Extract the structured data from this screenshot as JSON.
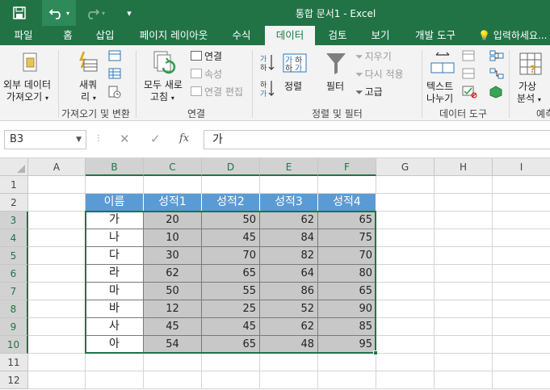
{
  "app": {
    "title": "통합 문서1  -  Excel",
    "accent": "#217346"
  },
  "quick_access": {
    "save_icon": "save-icon",
    "undo_icon": "undo-icon",
    "redo_icon": "redo-icon",
    "customize_icon": "customize-icon"
  },
  "tabs": [
    {
      "label": "파일"
    },
    {
      "label": "홈"
    },
    {
      "label": "삽입"
    },
    {
      "label": "페이지 레이아웃"
    },
    {
      "label": "수식"
    },
    {
      "label": "데이터"
    },
    {
      "label": "검토"
    },
    {
      "label": "보기"
    },
    {
      "label": "개발 도구"
    }
  ],
  "active_tab": "데이터",
  "tell_me": "입력하세요...",
  "ribbon": {
    "get_external": {
      "line1": "외부 데이터",
      "line2": "가져오기"
    },
    "new_query": {
      "line1": "새쿼",
      "line2": "리"
    },
    "group_get_transform": "가져오기 및 변환",
    "refresh_all": {
      "line1": "모두 새로",
      "line2": "고침"
    },
    "connections": "연결",
    "properties": "속성",
    "edit_links": "연결 편집",
    "group_connections": "연결",
    "sort": "정렬",
    "filter": "필터",
    "clear": "지우기",
    "reapply": "다시 적용",
    "advanced": "고급",
    "group_sort_filter": "정렬 및 필터",
    "text_to_columns": {
      "line1": "텍스트",
      "line2": "나누기"
    },
    "group_data_tools": "데이터 도구",
    "what_if": {
      "line1": "가상",
      "line2": "분석"
    },
    "group_forecast": "예측"
  },
  "formula_bar": {
    "name_box": "B3",
    "cancel_icon": "cancel-icon",
    "enter_icon": "enter-icon",
    "fx": "fx",
    "content": "가"
  },
  "sheet": {
    "columns": [
      "A",
      "B",
      "C",
      "D",
      "E",
      "F",
      "G",
      "H",
      "I"
    ],
    "rows": [
      "1",
      "2",
      "3",
      "4",
      "5",
      "6",
      "7",
      "8",
      "9",
      "10",
      "11",
      "12"
    ],
    "table": {
      "header": [
        "이름",
        "성적1",
        "성적2",
        "성적3",
        "성적4"
      ],
      "rows": [
        [
          "가",
          "20",
          "50",
          "62",
          "65"
        ],
        [
          "나",
          "10",
          "45",
          "84",
          "75"
        ],
        [
          "다",
          "30",
          "70",
          "82",
          "70"
        ],
        [
          "라",
          "62",
          "65",
          "64",
          "80"
        ],
        [
          "마",
          "50",
          "55",
          "86",
          "65"
        ],
        [
          "바",
          "12",
          "25",
          "52",
          "90"
        ],
        [
          "사",
          "45",
          "45",
          "62",
          "85"
        ],
        [
          "아",
          "54",
          "65",
          "48",
          "95"
        ]
      ]
    },
    "header_color": "#5b9bd5",
    "data_color": "#c8c8c8"
  }
}
